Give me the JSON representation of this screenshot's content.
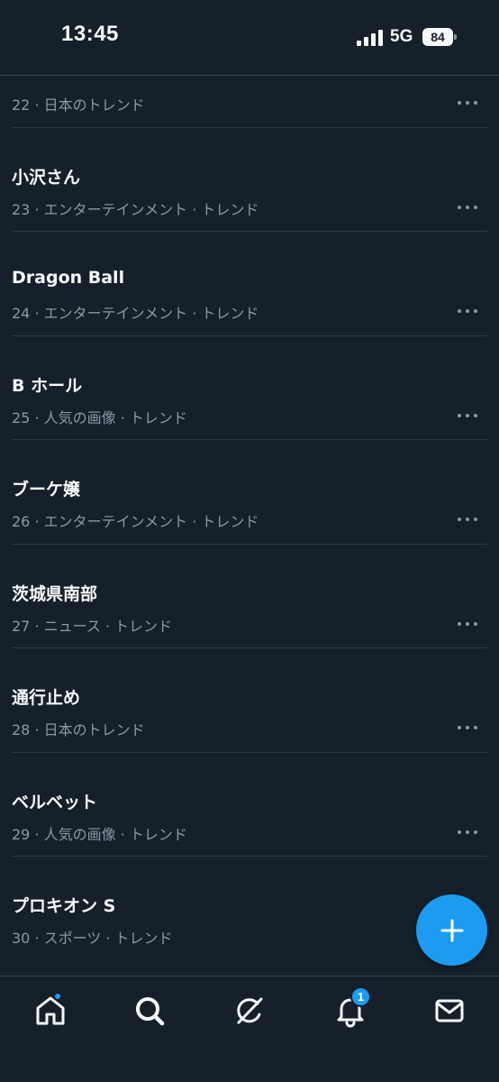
{
  "status_bar": {
    "time": "13:45",
    "network": "5G",
    "battery": "84",
    "signal_icon": "cellular-signal-icon",
    "battery_icon": "battery-icon"
  },
  "trends": [
    {
      "title": "",
      "meta": "22 · 日本のトレンド"
    },
    {
      "title": "小沢さん",
      "meta": "23 · エンターテインメント · トレンド"
    },
    {
      "title": "Dragon Ball",
      "meta": "24 · エンターテインメント · トレンド"
    },
    {
      "title": "B ホール",
      "meta": "25 · 人気の画像 · トレンド"
    },
    {
      "title": "ブーケ嬢",
      "meta": "26 · エンターテインメント · トレンド"
    },
    {
      "title": "茨城県南部",
      "meta": "27 · ニュース · トレンド"
    },
    {
      "title": "通行止め",
      "meta": "28 · 日本のトレンド"
    },
    {
      "title": "ベルベット",
      "meta": "29 · 人気の画像 · トレンド"
    },
    {
      "title": "プロキオン S",
      "meta": "30 · スポーツ · トレンド"
    }
  ],
  "fab": {
    "icon": "plus-icon"
  },
  "bottom_nav": {
    "items": [
      {
        "name": "home",
        "icon": "home-icon",
        "has_dot": true
      },
      {
        "name": "search",
        "icon": "search-icon"
      },
      {
        "name": "grok",
        "icon": "grok-icon"
      },
      {
        "name": "notifications",
        "icon": "bell-icon",
        "badge": "1"
      },
      {
        "name": "messages",
        "icon": "mail-icon"
      }
    ]
  },
  "colors": {
    "background": "#15202b",
    "divider": "#2f3b46",
    "text_primary": "#f7f9f9",
    "text_secondary": "#8b98a5",
    "accent": "#1d9bf0"
  }
}
